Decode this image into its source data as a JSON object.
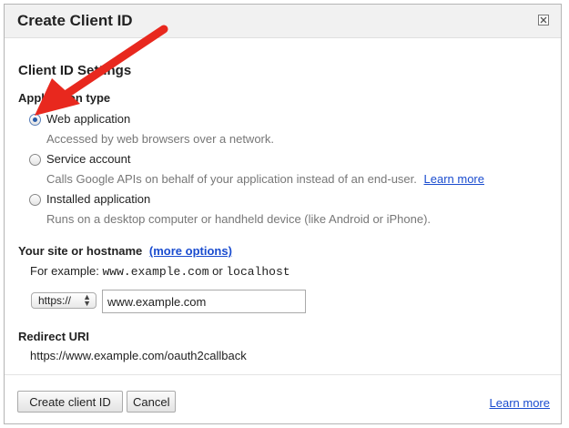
{
  "dialog": {
    "title": "Create Client ID",
    "close_icon": "close-icon"
  },
  "settings": {
    "section_title": "Client ID Settings",
    "app_type_label": "Application type",
    "options": [
      {
        "label": "Web application",
        "description": "Accessed by web browsers over a network.",
        "checked": true
      },
      {
        "label": "Service account",
        "description": "Calls Google APIs on behalf of your application instead of an end-user.",
        "learn_more": "Learn more",
        "checked": false
      },
      {
        "label": "Installed application",
        "description": "Runs on a desktop computer or handheld device (like Android or iPhone).",
        "checked": false
      }
    ]
  },
  "site": {
    "label": "Your site or hostname",
    "more_options": "(more options)",
    "example_prefix": "For example:",
    "example_host1": "www.example.com",
    "example_or": "or",
    "example_host2": "localhost",
    "protocol": "https://",
    "hostname": "www.example.com"
  },
  "redirect": {
    "label": "Redirect URI",
    "value": "https://www.example.com/oauth2callback"
  },
  "footer": {
    "create_button": "Create client ID",
    "cancel_button": "Cancel",
    "learn_more": "Learn more"
  },
  "colors": {
    "link": "#1a4ccf",
    "annotation_arrow": "#e8281e"
  }
}
